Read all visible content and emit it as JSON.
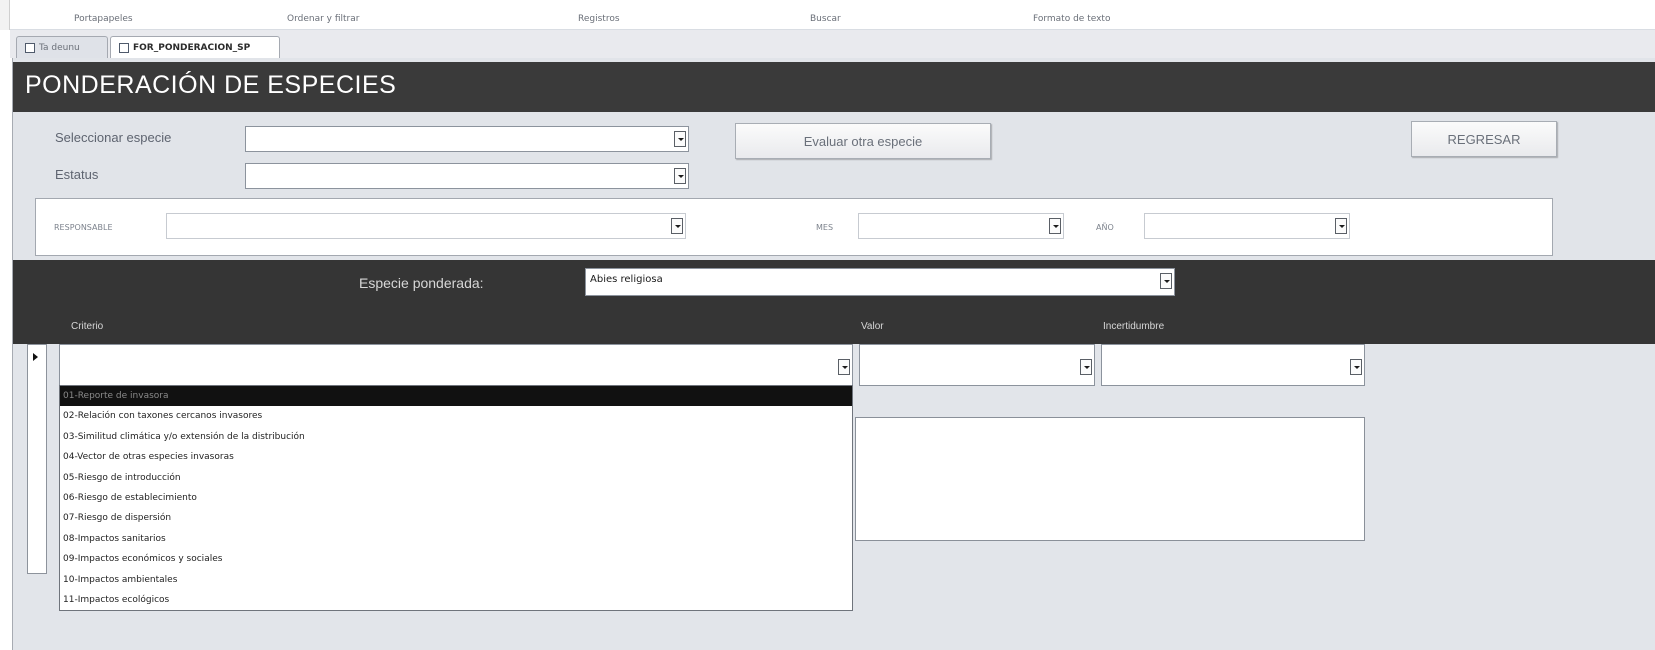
{
  "ribbon": {
    "items": [
      "Portapapeles",
      "Ordenar y filtrar",
      "Registros",
      "Buscar",
      "Formato de texto"
    ]
  },
  "tabs": [
    {
      "label": "Ta deunu"
    },
    {
      "label": "FOR_PONDERACION_SP"
    }
  ],
  "form": {
    "title": "PONDERACIÓN DE ESPECIES",
    "seleccionar_label": "Seleccionar especie",
    "estatus_label": "Estatus",
    "evaluar_button": "Evaluar otra especie",
    "regresar_button": "REGRESAR",
    "responsable_label": "RESPONSABLE",
    "mes_label": "MES",
    "anio_label": "AÑO",
    "especie_ponderada_label": "Especie ponderada:",
    "especie_ponderada_value": "Abies religiosa",
    "criterio_header": "Criterio",
    "valor_header": "Valor",
    "incertidumbre_header": "Incertidumbre"
  },
  "dropdown": {
    "items": [
      "01-Reporte de invasora",
      "02-Relación con taxones cercanos invasores",
      "03-Similitud climática y/o extensión de la distribución",
      "04-Vector de otras especies invasoras",
      "05-Riesgo de introducción",
      "06-Riesgo de establecimiento",
      "07-Riesgo de dispersión",
      "08-Impactos sanitarios",
      "09-Impactos económicos y sociales",
      "10-Impactos ambientales",
      "11-Impactos ecológicos"
    ],
    "selected_index": 0
  },
  "colors": {
    "header_bg": "#3a3a3a",
    "form_bg": "#e1e4e9",
    "selected_item_bg": "#111111"
  }
}
